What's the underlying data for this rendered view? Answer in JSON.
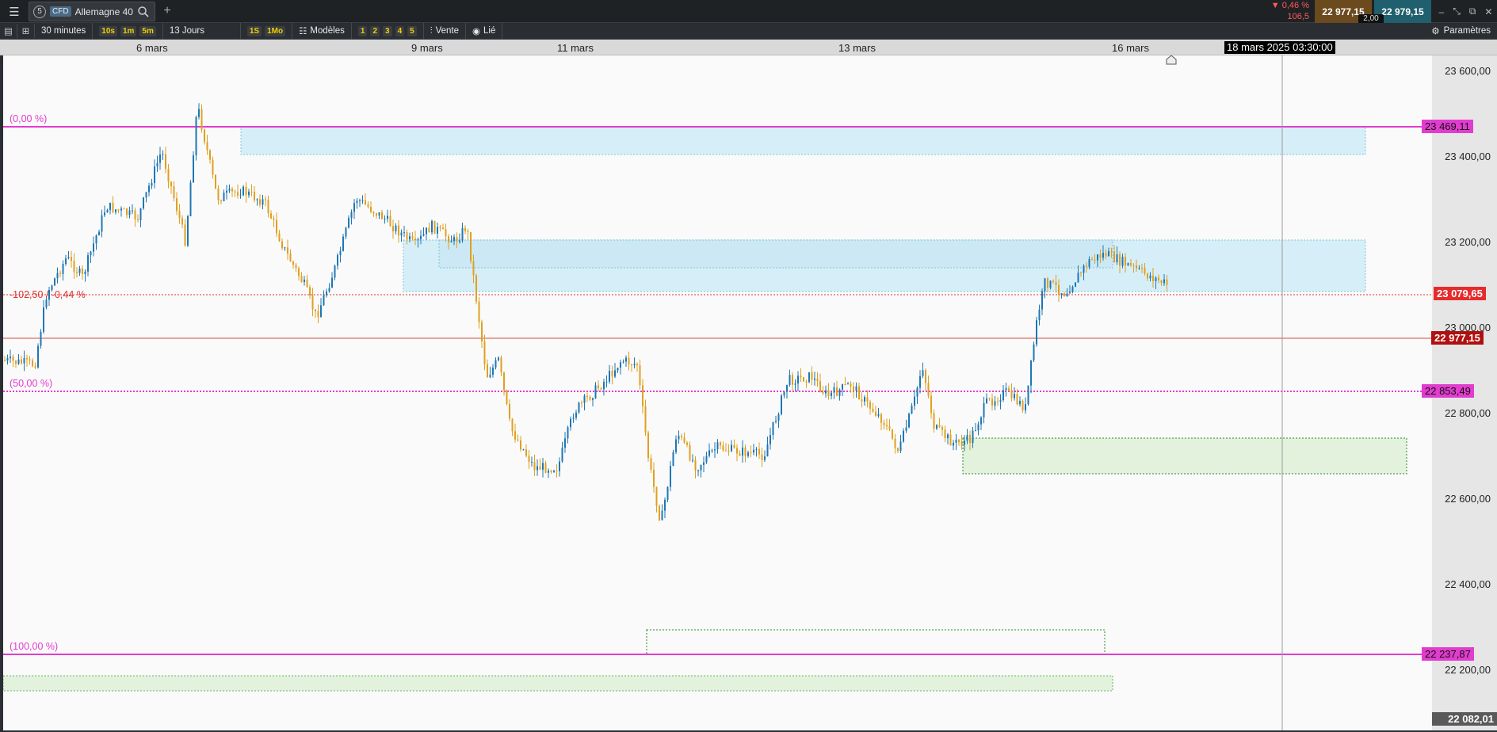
{
  "topbar": {
    "instrument_number": "5",
    "instrument_type": "CFD",
    "instrument_name": "Allemagne 40",
    "change_pct": "▼ 0,46 %",
    "change_abs": "106,5",
    "bid": "22 977,15",
    "ask": "22 979,15",
    "spread": "2,00"
  },
  "toolbar": {
    "timeframe": "30 minutes",
    "quick_tf": [
      "10s",
      "1m",
      "5m"
    ],
    "period": "13 Jours",
    "quick_period": [
      "1S",
      "1Mo"
    ],
    "templates": "Modèles",
    "layouts": [
      "1",
      "2",
      "3",
      "4",
      "5"
    ],
    "side": "Vente",
    "linked": "Lié",
    "settings": "Paramètres"
  },
  "dates": [
    "6 mars",
    "9 mars",
    "11 mars",
    "13 mars",
    "16 mars"
  ],
  "cursor_date": "18 mars 2025 03:30:00",
  "axis_labels": [
    "23 600,00",
    "23 400,00",
    "23 200,00",
    "23 000,00",
    "22 800,00",
    "22 600,00",
    "22 400,00",
    "22 200,00"
  ],
  "price_tags": {
    "fib_top": "23 469,11",
    "alert": "23 079,65",
    "last": "22 977,15",
    "fib_mid": "22 853,49",
    "fib_bottom": "22 237,87",
    "axis_min": "22 082,01"
  },
  "annotations": {
    "fib_0": "(0,00 %)",
    "fib_50": "(50,00 %)",
    "fib_100": "(100,00 %)",
    "alert_delta": "-102,50 / -0,44 %"
  },
  "colors": {
    "up": "#1f77b4",
    "down": "#e0a020",
    "fib": "#e23ccf",
    "alert": "#e03030",
    "last": "#c0392b",
    "zone_blue": "#d6eef7",
    "zone_green": "#e2f2dd"
  }
}
